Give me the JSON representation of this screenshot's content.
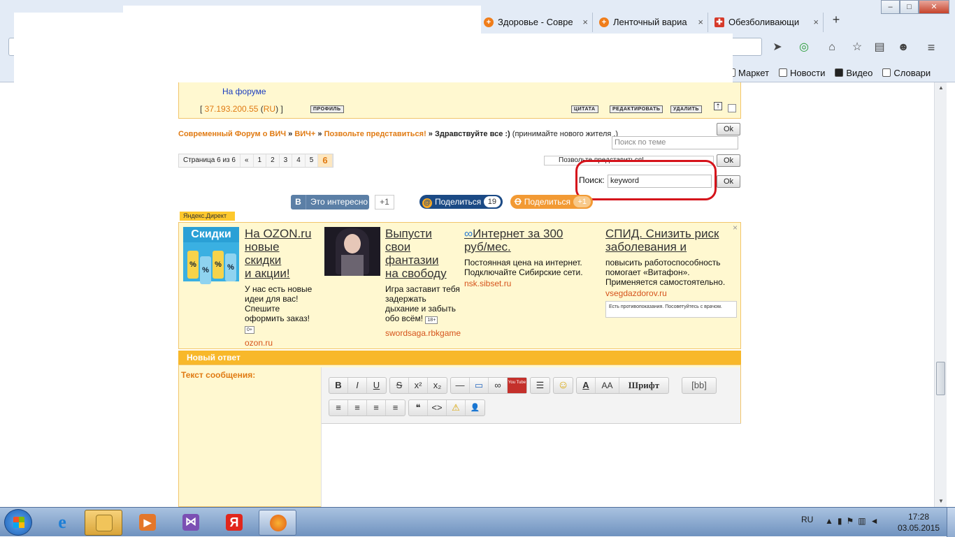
{
  "browser": {
    "tabs": [
      {
        "title": "Здоровье - Совре"
      },
      {
        "title": "Ленточный вариа"
      },
      {
        "title": "Обезболивающи"
      }
    ],
    "tab_close": "×",
    "new_tab": "+",
    "window_buttons": {
      "minimize": "‒",
      "maximize": "□",
      "close": "✕"
    },
    "bookmarks": [
      "Маркет",
      "Новости",
      "Видео",
      "Словари"
    ]
  },
  "post": {
    "on_forum": "На форуме",
    "ip_prefix": "[ ",
    "ip": "37.193.200.55",
    "ip_country_open": " (",
    "ip_country": "RU",
    "ip_country_close": ") ]",
    "profile_btn": "ПРОФИЛЬ",
    "quote_btn": "ЦИТАТА",
    "edit_btn": "РЕДАКТИРОВАТЬ",
    "delete_btn": "УДАЛИТЬ"
  },
  "breadcrumb": {
    "items": [
      "Современный Форум о ВИЧ",
      "ВИЧ+",
      "Позвольте представиться!"
    ],
    "sep": " » ",
    "current": "Здравствуйте все :)",
    "note": "(принимайте нового жителя .)"
  },
  "topic_search": {
    "placeholder": "Поиск по теме",
    "ok": "Ok"
  },
  "pager": {
    "label": "Страница 6 из 6",
    "prev": "«",
    "pages": [
      "1",
      "2",
      "3",
      "4",
      "5"
    ],
    "current": "6"
  },
  "jump": {
    "value": "Позвольте представиться!",
    "ok": "Ok"
  },
  "search": {
    "label": "Поиск:",
    "value": "keyword",
    "ok": "Ok"
  },
  "share": {
    "vk_label": "Это интересно",
    "vk_icon": "В",
    "vk_plus": "+1",
    "mail_label": "Поделиться",
    "mail_count": "19",
    "ok_label": "Поделиться",
    "ok_count": "+1"
  },
  "yandex_direct": {
    "tag": "Яндекс.Директ",
    "close": "×",
    "ads": [
      {
        "title_lines": [
          "На OZON.ru",
          "новые",
          "скидки",
          "и акции!"
        ],
        "text": "У нас есть новые идеи для вас! Спешите оформить заказ!",
        "age": "0+",
        "url": "ozon.ru",
        "image_label": "Скидки"
      },
      {
        "title_lines": [
          "Выпусти",
          "свои",
          "фантазии",
          "на свободу"
        ],
        "text": "Игра заставит тебя задержать дыхание и забыть обо всём!",
        "age": "18+",
        "url": "swordsaga.rbkgame"
      },
      {
        "title_lines": [
          "Интернет за 300",
          "руб/мес."
        ],
        "text": "Постоянная цена на интернет. Подключайте Сибирские сети.",
        "url": "nsk.sibset.ru"
      },
      {
        "title_lines": [
          "СПИД. Снизить риск",
          "заболевания и"
        ],
        "text": "повысить работоспособность помогает «Витафон». Применяется самостоятельно.",
        "url": "vsegdazdorov.ru",
        "disclaimer": "Есть противопоказания. Посоветуйтесь с врачом."
      }
    ]
  },
  "reply": {
    "header": "Новый ответ",
    "label": "Текст сообщения:",
    "toolbar_row1": [
      [
        "B",
        "I",
        "U"
      ],
      [
        "S",
        "x²",
        "x₂"
      ],
      [
        "—",
        "▭",
        "∞",
        "You Tube"
      ],
      [
        "☰"
      ],
      [
        "☺"
      ],
      [
        "A",
        "AA",
        "Шрифт"
      ],
      [
        "[bb]"
      ]
    ],
    "toolbar_row2": [
      [
        "≡",
        "≡",
        "≡",
        "≡"
      ],
      [
        "❝",
        "<>",
        "⚠",
        "👤"
      ]
    ]
  },
  "taskbar": {
    "lang": "RU",
    "time": "17:28",
    "date": "03.05.2015"
  }
}
